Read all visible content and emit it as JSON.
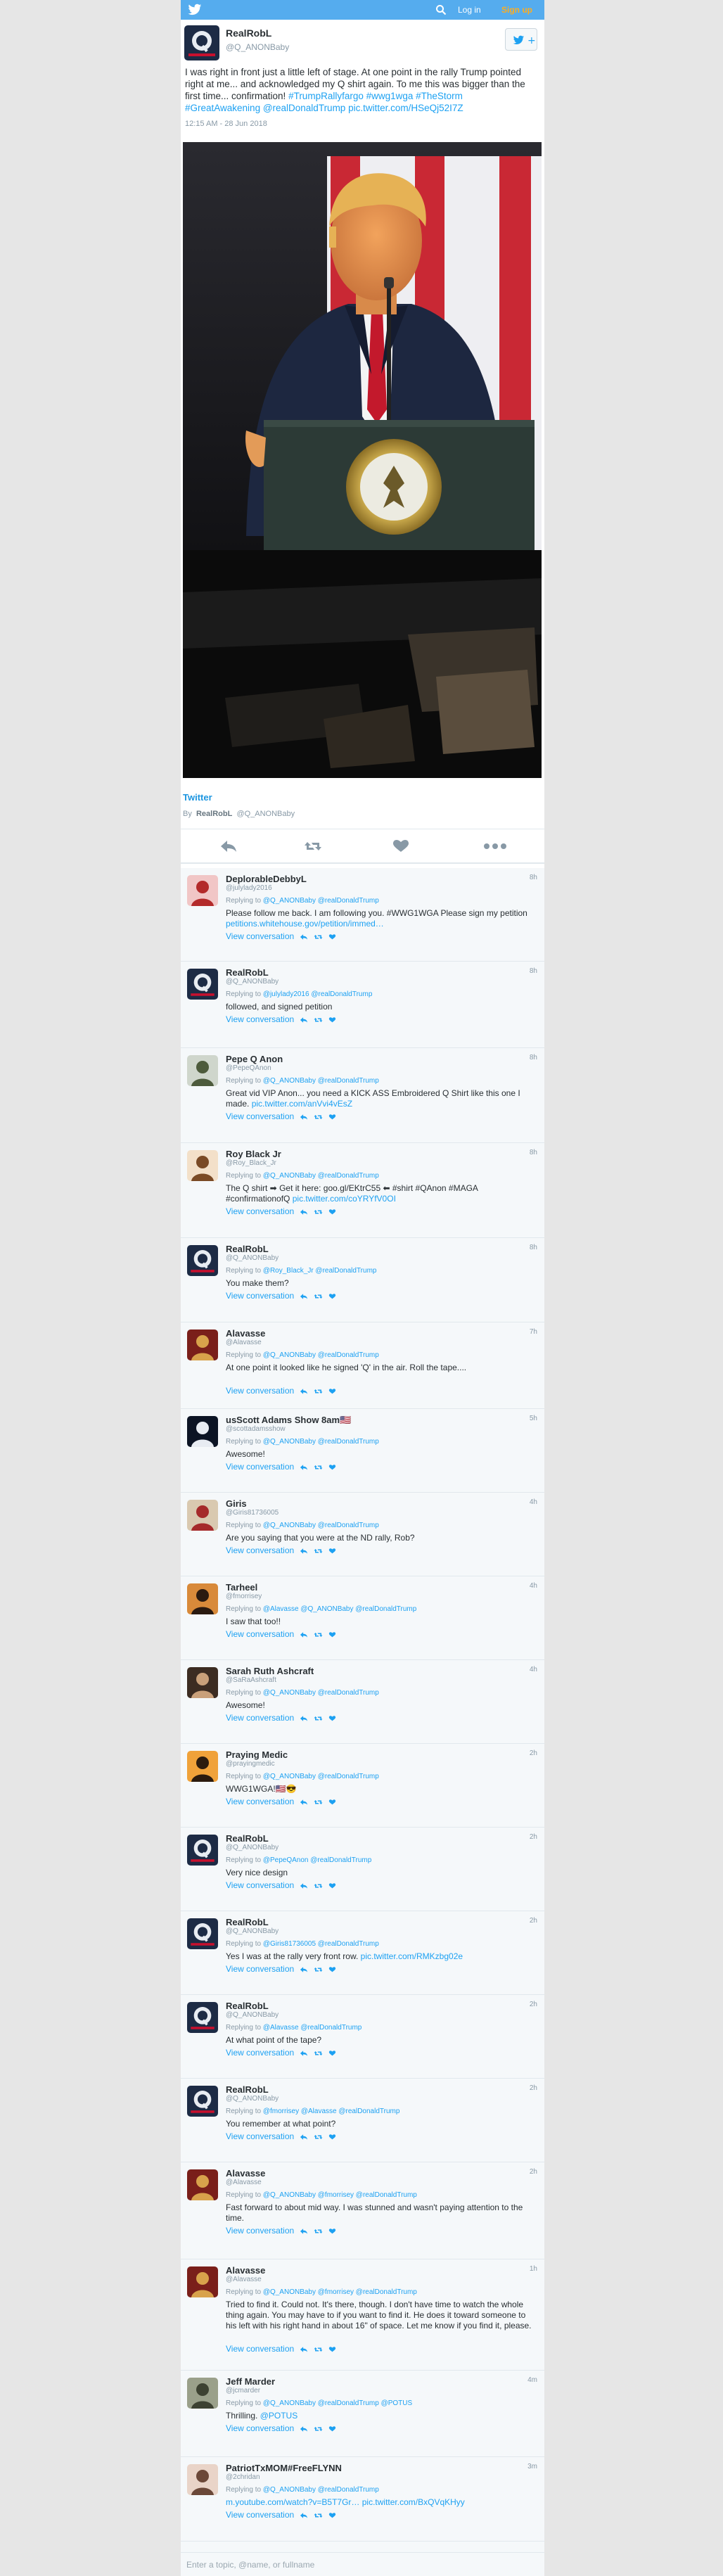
{
  "topbar": {
    "login": "Log in",
    "signup": "Sign up"
  },
  "tweet": {
    "name": "RealRobL",
    "handle": "@Q_ANONBaby",
    "text": "I was right in front just a little left of stage. At one point in the rally Trump pointed right at me... and acknowledged my Q shirt again. To me this was bigger than the first time... confirmation!",
    "hashtags": "#TrumpRallyfargo #wwg1wga #TheStorm #GreatAwakening @realDonaldTrump pic.twitter.com/HSeQj52I7Z",
    "time": "12:15 AM - 28 Jun 2018",
    "card_label": "Twitter",
    "card_by_prefix": "By",
    "card_by_name": "RealRobL",
    "card_by_handle": "@Q_ANONBaby"
  },
  "colors": {
    "accent": "#1da1f2",
    "topbar": "#55acee",
    "signup": "#ffad1f"
  },
  "icons": {
    "bird": "twitter-bird-icon",
    "search": "search-icon",
    "follow": "follow-user-icon",
    "reply": "reply-icon",
    "retweet": "retweet-icon",
    "like": "heart-icon",
    "more": "more-icon"
  },
  "view_conversation": "View conversation",
  "replying_to_label": "Replying to",
  "replies": [
    {
      "name": "DeplorableDebbyL",
      "handle": "@julylady2016",
      "time": "8h",
      "replying": "@Q_ANONBaby @realDonaldTrump",
      "text": "Please follow me back. I am following you. #WWG1WGA Please sign my petition",
      "link": "petitions.whitehouse.gov/petition/immed…"
    },
    {
      "name": "RealRobL",
      "handle": "@Q_ANONBaby",
      "time": "8h",
      "replying": "@julylady2016 @realDonaldTrump",
      "text": "followed, and signed petition",
      "link": ""
    },
    {
      "name": "Pepe Q Anon",
      "handle": "@PepeQAnon",
      "time": "8h",
      "replying": "@Q_ANONBaby @realDonaldTrump",
      "text": "Great vid VIP Anon... you need a KICK ASS Embroidered Q Shirt like this one I made.",
      "link": "pic.twitter.com/anVvi4vEsZ"
    },
    {
      "name": "Roy Black Jr",
      "handle": "@Roy_Black_Jr",
      "time": "8h",
      "replying": "@Q_ANONBaby @realDonaldTrump",
      "text": "The Q shirt ➡ Get it here: goo.gl/EKtrC55 ⬅ #shirt #QAnon #MAGA #confirmationofQ",
      "link": "pic.twitter.com/coYRYfV0OI"
    },
    {
      "name": "RealRobL",
      "handle": "@Q_ANONBaby",
      "time": "8h",
      "replying": "@Roy_Black_Jr @realDonaldTrump",
      "text": "You make them?",
      "link": ""
    },
    {
      "name": "Alavasse",
      "handle": "@Alavasse",
      "time": "7h",
      "replying": "@Q_ANONBaby @realDonaldTrump",
      "text": "At one point it looked like he signed 'Q' in the air. Roll the tape....",
      "link": ""
    },
    {
      "name": "usScott Adams Show 8am🇺🇸",
      "handle": "@scottadamsshow",
      "time": "5h",
      "replying": "@Q_ANONBaby @realDonaldTrump",
      "text": "Awesome!",
      "link": ""
    },
    {
      "name": "Giris",
      "handle": "@Giris81736005",
      "time": "4h",
      "replying": "@Q_ANONBaby @realDonaldTrump",
      "text": "Are you saying that you were at the ND rally, Rob?",
      "link": ""
    },
    {
      "name": "Tarheel",
      "handle": "@fmorrisey",
      "time": "4h",
      "replying": "@Alavasse @Q_ANONBaby @realDonaldTrump",
      "text": "I saw that too!!",
      "link": ""
    },
    {
      "name": "Sarah Ruth Ashcraft",
      "handle": "@SaRaAshcraft",
      "time": "4h",
      "replying": "@Q_ANONBaby @realDonaldTrump",
      "text": "Awesome!",
      "link": ""
    },
    {
      "name": "Praying Medic",
      "handle": "@prayingmedic",
      "time": "2h",
      "replying": "@Q_ANONBaby @realDonaldTrump",
      "text": "WWG1WGA!🇺🇸😎",
      "link": ""
    },
    {
      "name": "RealRobL",
      "handle": "@Q_ANONBaby",
      "time": "2h",
      "replying": "@PepeQAnon @realDonaldTrump",
      "text": "Very nice design",
      "link": ""
    },
    {
      "name": "RealRobL",
      "handle": "@Q_ANONBaby",
      "time": "2h",
      "replying": "@Giris81736005 @realDonaldTrump",
      "text": "Yes I was at the rally very front row.",
      "link": "pic.twitter.com/RMKzbg02e"
    },
    {
      "name": "RealRobL",
      "handle": "@Q_ANONBaby",
      "time": "2h",
      "replying": "@Alavasse @realDonaldTrump",
      "text": "At what point of the tape?",
      "link": ""
    },
    {
      "name": "RealRobL",
      "handle": "@Q_ANONBaby",
      "time": "2h",
      "replying": "@fmorrisey @Alavasse @realDonaldTrump",
      "text": "You remember at what point?",
      "link": ""
    },
    {
      "name": "Alavasse",
      "handle": "@Alavasse",
      "time": "2h",
      "replying": "@Q_ANONBaby @fmorrisey @realDonaldTrump",
      "text": "Fast forward to about mid way. I was stunned and wasn't paying attention to the time.",
      "link": ""
    },
    {
      "name": "Alavasse",
      "handle": "@Alavasse",
      "time": "1h",
      "replying": "@Q_ANONBaby @fmorrisey @realDonaldTrump",
      "text": "Tried to find it. Could not. It's there, though. I don't have time to watch the whole thing again. You may have to if you want to find it. He does it toward someone to his left with his right hand in about 16\" of space. Let me know if you find it, please.",
      "link": ""
    },
    {
      "name": "Jeff Marder",
      "handle": "@jcmarder",
      "time": "4m",
      "replying": "@Q_ANONBaby @realDonaldTrump @POTUS",
      "text": "Thrilling.",
      "link": "@POTUS"
    },
    {
      "name": "PatriotTxMOM#FreeFLYNN",
      "handle": "@2chridan",
      "time": "3m",
      "replying": "@Q_ANONBaby @realDonaldTrump",
      "text": "",
      "link": "m.youtube.com/watch?v=B5T7Gr…  pic.twitter.com/BxQVqKHyy"
    }
  ],
  "bottom_search_placeholder": "Enter a topic, @name, or fullname"
}
